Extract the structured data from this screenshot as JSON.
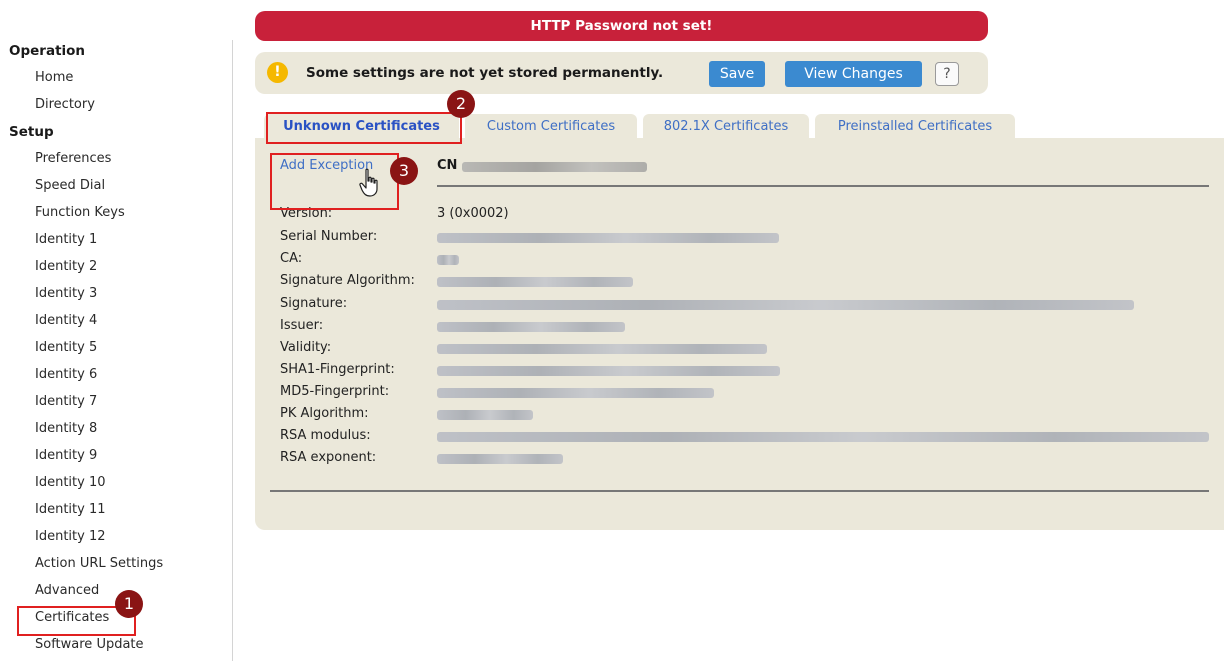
{
  "alert": {
    "text": "HTTP Password not set!"
  },
  "notice": {
    "text": "Some settings are not yet stored permanently.",
    "save_label": "Save",
    "view_changes_label": "View Changes",
    "help_label": "?",
    "icon": "warning-icon",
    "icon_glyph": "!"
  },
  "sidebar": {
    "operation_heading": "Operation",
    "operation_items": [
      {
        "label": "Home"
      },
      {
        "label": "Directory"
      }
    ],
    "setup_heading": "Setup",
    "setup_items": [
      {
        "label": "Preferences"
      },
      {
        "label": "Speed Dial"
      },
      {
        "label": "Function Keys"
      },
      {
        "label": "Identity 1"
      },
      {
        "label": "Identity 2"
      },
      {
        "label": "Identity 3"
      },
      {
        "label": "Identity 4"
      },
      {
        "label": "Identity 5"
      },
      {
        "label": "Identity 6"
      },
      {
        "label": "Identity 7"
      },
      {
        "label": "Identity 8"
      },
      {
        "label": "Identity 9"
      },
      {
        "label": "Identity 10"
      },
      {
        "label": "Identity 11"
      },
      {
        "label": "Identity 12"
      },
      {
        "label": "Action URL Settings"
      },
      {
        "label": "Advanced"
      },
      {
        "label": "Certificates"
      },
      {
        "label": "Software Update"
      }
    ]
  },
  "tabs": [
    {
      "label": "Unknown Certificates",
      "active": true
    },
    {
      "label": "Custom Certificates",
      "active": false
    },
    {
      "label": "802.1X Certificates",
      "active": false
    },
    {
      "label": "Preinstalled Certificates",
      "active": false
    }
  ],
  "certificate": {
    "add_exception_label": "Add Exception",
    "cn_label": "CN",
    "fields": [
      {
        "label": "Version:",
        "value": "3 (0x0002)"
      },
      {
        "label": "Serial Number:",
        "value": ""
      },
      {
        "label": "CA:",
        "value": ""
      },
      {
        "label": "Signature Algorithm:",
        "value": ""
      },
      {
        "label": "Signature:",
        "value": ""
      },
      {
        "label": "Issuer:",
        "value": ""
      },
      {
        "label": "Validity:",
        "value": ""
      },
      {
        "label": "SHA1-Fingerprint:",
        "value": ""
      },
      {
        "label": "MD5-Fingerprint:",
        "value": ""
      },
      {
        "label": "PK Algorithm:",
        "value": ""
      },
      {
        "label": "RSA modulus:",
        "value": ""
      },
      {
        "label": "RSA exponent:",
        "value": ""
      }
    ]
  },
  "annotations": {
    "step1": "1",
    "step2": "2",
    "step3": "3",
    "box_color": "#e02020",
    "badge_color": "#8a1414"
  },
  "colors": {
    "alert_bg": "#c8213a",
    "panel_bg": "#ebe8da",
    "button_blue": "#3b8ad0",
    "link_blue": "#3f6fc5",
    "warning_yellow": "#f5b800"
  }
}
